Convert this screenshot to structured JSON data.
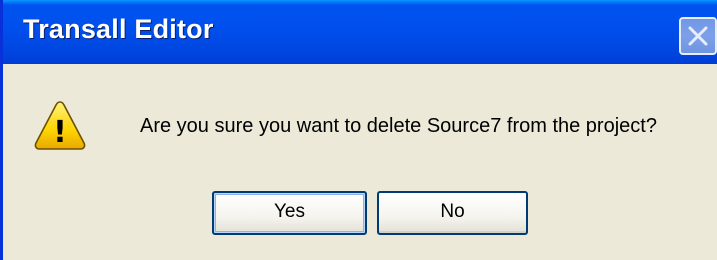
{
  "window": {
    "title": "Transall Editor"
  },
  "dialog": {
    "icon": "warning-icon",
    "icon_symbol": "!",
    "message": "Are you sure you want to delete Source7 from the project?"
  },
  "buttons": {
    "yes_label": "Yes",
    "no_label": "No"
  },
  "colors": {
    "titlebar": "#0050ee",
    "dialog_background": "#ece9d8",
    "button_border": "#003c74",
    "warning_fill": "#ffd700"
  }
}
